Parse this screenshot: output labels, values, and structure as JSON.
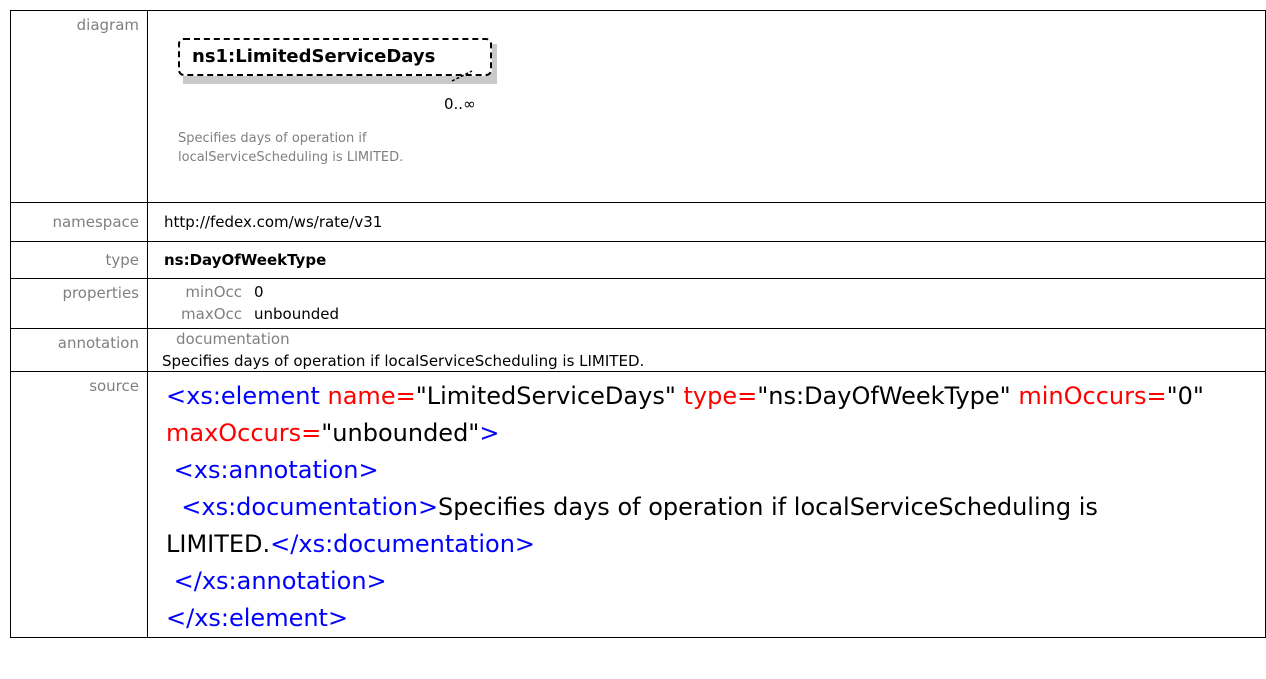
{
  "rows": {
    "diagram": {
      "label": "diagram",
      "element_prefix": "ns1:",
      "element_name": "LimitedServiceDays",
      "occurrence": "0..∞",
      "note": "Specifies days of operation if localServiceScheduling is LIMITED."
    },
    "namespace": {
      "label": "namespace",
      "value": "http://fedex.com/ws/rate/v31"
    },
    "type": {
      "label": "type",
      "value": "ns:DayOfWeekType"
    },
    "properties": {
      "label": "properties",
      "items": [
        {
          "key": "minOcc",
          "value": "0"
        },
        {
          "key": "maxOcc",
          "value": "unbounded"
        }
      ]
    },
    "annotation": {
      "label": "annotation",
      "heading": "documentation",
      "text": "Specifies days of operation if localServiceScheduling  is LIMITED."
    },
    "source": {
      "label": "source",
      "tokens": {
        "open_element": "<xs:element",
        "attr_name": "name=",
        "attr_name_val": "\"LimitedServiceDays\"",
        "attr_type": "type=",
        "attr_type_val": "\"ns:DayOfWeekType\"",
        "attr_min": "minOccurs=",
        "attr_min_val": "\"0\"",
        "attr_max": "maxOccurs=",
        "attr_max_val": "\"unbounded\"",
        "close_bracket": ">",
        "open_annotation": "<xs:annotation>",
        "open_documentation": "<xs:documentation>",
        "doc_text_1": "Specifies days of operation if localServiceScheduling is",
        "doc_text_2": "LIMITED.",
        "close_documentation": "</xs:documentation>",
        "close_annotation": "</xs:annotation>",
        "close_element": "</xs:element>"
      }
    }
  }
}
